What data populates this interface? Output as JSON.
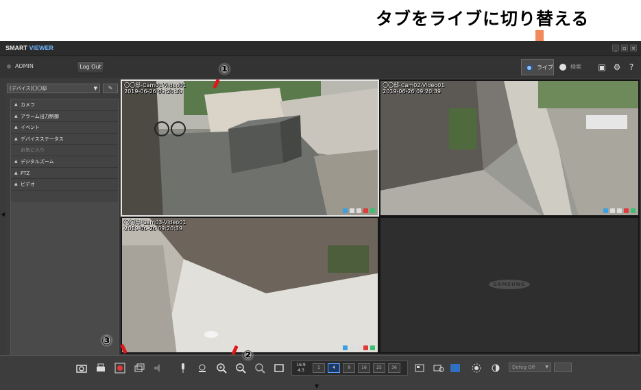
{
  "annotation": {
    "text": "タブをライブに切り替える",
    "arrow_color": "#f08a5d"
  },
  "app": {
    "title_a": "SMART ",
    "title_b": "VIEWER",
    "window_buttons": [
      "_",
      "▫",
      "×"
    ],
    "user": "ADMIN",
    "logout": "Log Out",
    "tabs": {
      "live": "ライブ",
      "search": "検索"
    }
  },
  "sidebar": {
    "device_select": "[デバイス]〇〇邸",
    "items": [
      {
        "label": "カメラ",
        "enabled": true
      },
      {
        "label": "アラーム出力制御",
        "enabled": true
      },
      {
        "label": "イベント",
        "enabled": true
      },
      {
        "label": "デバイスステータス",
        "enabled": true
      },
      {
        "label": "お気に入り",
        "enabled": false
      },
      {
        "label": "デジタルズーム",
        "enabled": true
      },
      {
        "label": "PTZ",
        "enabled": true
      },
      {
        "label": "ビデオ",
        "enabled": true
      }
    ]
  },
  "cameras": [
    {
      "name": "〇〇邸-Cam01-Video01",
      "time": "2019-06-26 09:20:39"
    },
    {
      "name": "〇〇邸-Cam02-Video01",
      "time": "2019-06-26 09:20:39"
    },
    {
      "name": "〇〇邸-Cam03-Video01",
      "time": "2019-06-26 09:20:39"
    }
  ],
  "empty_tile_logo": "SAMSUNG",
  "toolbar": {
    "ratio_top": "16:9",
    "ratio_bottom": "4:3",
    "layouts": [
      "1",
      "4",
      "9",
      "16",
      "25",
      "36"
    ],
    "active_layout": "4",
    "defog": "Defog Off"
  },
  "callouts": {
    "one": "①",
    "two": "②",
    "three": "③"
  }
}
